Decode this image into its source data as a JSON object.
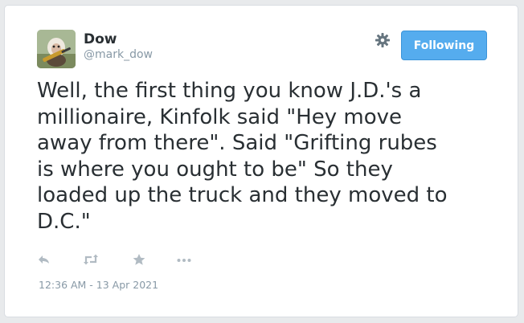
{
  "user": {
    "name": "Dow",
    "handle": "@mark_dow",
    "avatar": "avatar-image"
  },
  "header": {
    "follow_label": "Following",
    "settings_icon": "gear-icon",
    "accent_color": "#55acee"
  },
  "tweet": {
    "text": "Well, the first thing you know J.D.'s a\nmillionaire, Kinfolk said \"Hey move\naway from there\". Said \"Grifting rubes\nis where you ought to be\" So they\nloaded up the truck and they moved to\nD.C.\"",
    "timestamp": "12:36 AM - 13 Apr 2021"
  },
  "actions": [
    {
      "icon": "reply-icon"
    },
    {
      "icon": "retweet-icon"
    },
    {
      "icon": "favorite-star-icon"
    },
    {
      "icon": "more-icon"
    }
  ]
}
